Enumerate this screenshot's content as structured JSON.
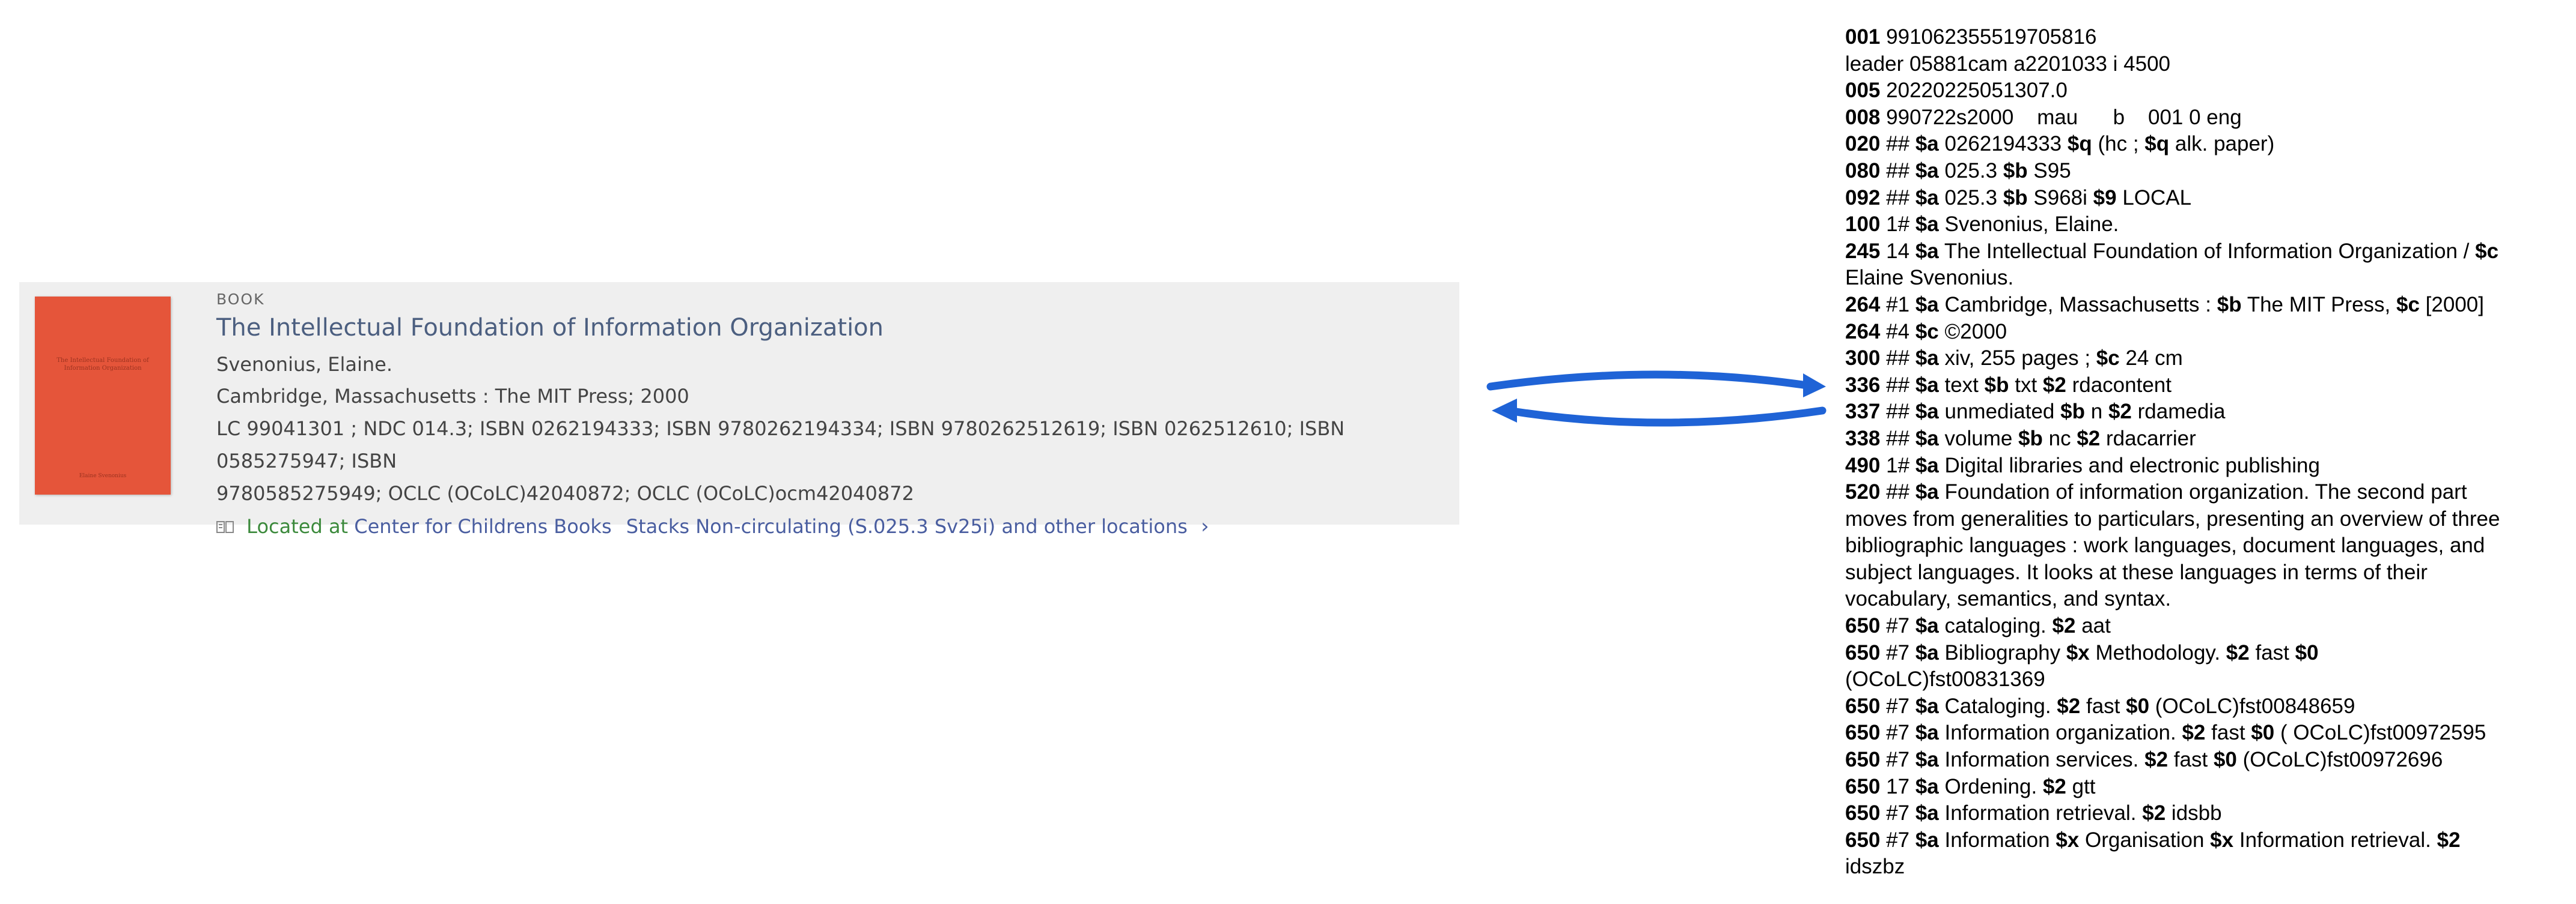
{
  "catalog": {
    "type_label": "BOOK",
    "title": "The Intellectual Foundation of Information Organization",
    "author": "Svenonius, Elaine.",
    "publication": "Cambridge, Massachusetts : The MIT Press; 2000",
    "identifiers_line1": "LC 99041301 ; NDC 014.3; ISBN 0262194333; ISBN 9780262194334; ISBN 9780262512619; ISBN 0262512610; ISBN 0585275947; ISBN",
    "identifiers_line2": "9780585275949; OCLC (OCoLC)42040872; OCLC (OCoLC)ocm42040872",
    "location_label": "Located at",
    "location_library": "Center for Childrens Books",
    "location_shelf": "Stacks Non-circulating (S.025.3 Sv25i) and other locations",
    "location_chevron": "›",
    "cover": {
      "title": "The Intellectual Foundation of Information Organization",
      "author": "Elaine Svenonius",
      "color": "#e5553a"
    }
  },
  "arrow_color": "#1f63d6",
  "marc": {
    "r001": {
      "tag": "001",
      "value": "991062355519705816"
    },
    "leader": {
      "label": "leader",
      "value": "05881cam a2201033 i 4500"
    },
    "r005": {
      "tag": "005",
      "value": "20220225051307.0"
    },
    "r008": {
      "tag": "008",
      "value": "990722s2000    mau      b    001 0 eng"
    },
    "r020": {
      "tag": "020",
      "ind": "##",
      "a": "0262194333",
      "q1": "(hc ;",
      "q2": "alk. paper)"
    },
    "r080": {
      "tag": "080",
      "ind": "##",
      "a": "025.3",
      "b": "S95"
    },
    "r092": {
      "tag": "092",
      "ind": "##",
      "a": "025.3",
      "b": "S968i",
      "s9": "LOCAL"
    },
    "r100": {
      "tag": "100",
      "ind": "1#",
      "a": "Svenonius, Elaine."
    },
    "r245": {
      "tag": "245",
      "ind": "14",
      "a": "The Intellectual Foundation of Information Organization /",
      "c": "Elaine Svenonius."
    },
    "r264a": {
      "tag": "264",
      "ind": "#1",
      "a": "Cambridge, Massachusetts :",
      "b": "The MIT Press,",
      "c": "[2000]"
    },
    "r264b": {
      "tag": "264",
      "ind": "#4",
      "c": "©2000"
    },
    "r300": {
      "tag": "300",
      "ind": "##",
      "a": "xiv, 255 pages ;",
      "c": "24 cm"
    },
    "r336": {
      "tag": "336",
      "ind": "##",
      "a": "text",
      "b": "txt",
      "s2": "rdacontent"
    },
    "r337": {
      "tag": "337",
      "ind": "##",
      "a": "unmediated",
      "b": "n",
      "s2": "rdamedia"
    },
    "r338": {
      "tag": "338",
      "ind": "##",
      "a": "volume",
      "b": "nc",
      "s2": "rdacarrier"
    },
    "r490": {
      "tag": "490",
      "ind": "1#",
      "a": "Digital libraries and electronic publishing"
    },
    "r520": {
      "tag": "520",
      "ind": "##",
      "a1": "Foundation of information organization. The second part",
      "l2": "moves from generalities to particulars, presenting an overview of three",
      "l3": "bibliographic languages : work languages, document languages, and",
      "l4": "subject languages. It looks at these languages in terms of their",
      "l5": "vocabulary, semantics, and syntax."
    },
    "r650a": {
      "tag": "650",
      "ind": "#7",
      "a": "cataloging.",
      "s2": "aat"
    },
    "r650b": {
      "tag": "650",
      "ind": "#7",
      "a": "Bibliography",
      "x": "Methodology.",
      "s2": "fast",
      "l2": "(OCoLC)fst00831369"
    },
    "r650c": {
      "tag": "650",
      "ind": "#7",
      "a": "Cataloging.",
      "s2": "fast",
      "s0": "(OCoLC)fst00848659"
    },
    "r650d": {
      "tag": "650",
      "ind": "#7",
      "a": "Information organization.",
      "s2": "fast",
      "s0": "( OCoLC)fst00972595"
    },
    "r650e": {
      "tag": "650",
      "ind": "#7",
      "a": "Information services.",
      "s2": "fast",
      "s0": "(OCoLC)fst00972696"
    },
    "r650f": {
      "tag": "650",
      "ind": "17",
      "a": "Ordening.",
      "s2": "gtt"
    },
    "r650g": {
      "tag": "650",
      "ind": "#7",
      "a": "Information retrieval.",
      "s2": "idsbb"
    },
    "r650h": {
      "tag": "650",
      "ind": "#7",
      "a": "Information",
      "x1": "Organisation",
      "x2": "Information retrieval.",
      "l2": "idszbz"
    },
    "sub": {
      "a": "$a",
      "b": "$b",
      "c": "$c",
      "q": "$q",
      "x": "$x",
      "s0": "$0",
      "s2": "$2",
      "s9": "$9"
    }
  }
}
